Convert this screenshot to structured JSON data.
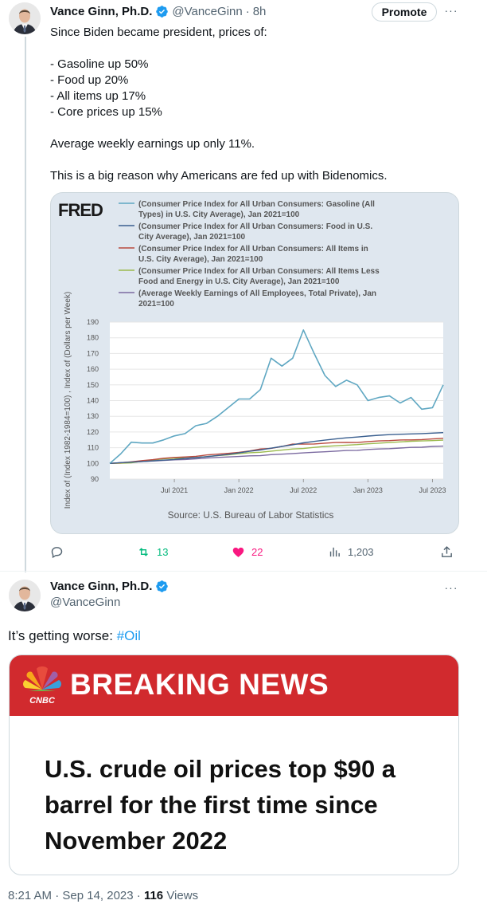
{
  "tweet1": {
    "name": "Vance Ginn, Ph.D.",
    "handle": "@VanceGinn",
    "time": "8h",
    "promote_label": "Promote",
    "more_label": "···",
    "text": "Since Biden became president, prices of:\n\n- Gasoline up 50%\n- Food up 20%\n- All items up 17%\n- Core prices up 15%\n\nAverage weekly earnings up only 11%.\n\nThis is a big reason why Americans are fed up with Bidenomics.",
    "actions": {
      "reply_count": "",
      "retweet_count": "13",
      "like_count": "22",
      "views_count": "1,203"
    },
    "colors": {
      "retweet": "#00ba7c",
      "like": "#f91880",
      "verified": "#1d9bf0"
    }
  },
  "chart": {
    "logo": "FRED",
    "ylabel": "Index of (Index 1982-1984=100) , Index of (Dollars per Week)",
    "source": "Source: U.S. Bureau of Labor Statistics",
    "legend": [
      {
        "lines": [
          "(Consumer Price Index for All Urban Consumers: Gasoline (All",
          "Types) in U.S. City Average), Jan 2021=100"
        ],
        "color": "#5fa7c2"
      },
      {
        "lines": [
          "(Consumer Price Index for All Urban Consumers: Food in U.S.",
          "City Average), Jan 2021=100"
        ],
        "color": "#3a5f8f"
      },
      {
        "lines": [
          "(Consumer Price Index for All Urban Consumers: All Items in",
          "U.S. City Average), Jan 2021=100"
        ],
        "color": "#b94a3f"
      },
      {
        "lines": [
          "(Consumer Price Index for All Urban Consumers: All Items Less",
          "Food and Energy in U.S. City Average), Jan 2021=100"
        ],
        "color": "#9bba4e"
      },
      {
        "lines": [
          "(Average Weekly Earnings of All Employees, Total Private), Jan",
          "2021=100"
        ],
        "color": "#7b6aa0"
      }
    ]
  },
  "chart_data": {
    "type": "line",
    "ylim": [
      90,
      190
    ],
    "yticks": [
      "190",
      "180",
      "170",
      "160",
      "150",
      "140",
      "130",
      "120",
      "110",
      "100",
      "90"
    ],
    "xticks": [
      "Jul 2021",
      "Jan 2022",
      "Jul 2022",
      "Jan 2023",
      "Jul 2023"
    ],
    "x": [
      "Jan 2021",
      "Feb 2021",
      "Mar 2021",
      "Apr 2021",
      "May 2021",
      "Jun 2021",
      "Jul 2021",
      "Aug 2021",
      "Sep 2021",
      "Oct 2021",
      "Nov 2021",
      "Dec 2021",
      "Jan 2022",
      "Feb 2022",
      "Mar 2022",
      "Apr 2022",
      "May 2022",
      "Jun 2022",
      "Jul 2022",
      "Aug 2022",
      "Sep 2022",
      "Oct 2022",
      "Nov 2022",
      "Dec 2022",
      "Jan 2023",
      "Feb 2023",
      "Mar 2023",
      "Apr 2023",
      "May 2023",
      "Jun 2023",
      "Jul 2023",
      "Aug 2023"
    ],
    "series": [
      {
        "values": [
          100,
          106,
          113.5,
          113,
          113,
          115,
          117.5,
          119,
          124,
          125.5,
          130,
          135.5,
          141,
          141,
          147,
          167,
          162,
          167,
          185,
          170,
          156,
          149,
          153,
          150,
          140,
          142,
          143,
          138.5,
          142,
          134.5,
          135.5,
          150
        ]
      },
      {
        "values": [
          100,
          100.5,
          100.8,
          101.2,
          101.6,
          102.1,
          102.5,
          103.2,
          103.7,
          104.3,
          105.0,
          105.8,
          106.7,
          107.7,
          108.6,
          109.7,
          110.8,
          111.9,
          113.1,
          114.0,
          114.8,
          115.6,
          116.3,
          116.8,
          117.4,
          117.9,
          118.3,
          118.6,
          118.8,
          119.0,
          119.3,
          119.6
        ]
      },
      {
        "values": [
          100,
          100.4,
          101.0,
          101.8,
          102.4,
          103.3,
          103.8,
          104.1,
          104.5,
          105.4,
          105.9,
          106.4,
          107.0,
          107.9,
          109.2,
          109.6,
          110.8,
          112.3,
          112.3,
          112.4,
          112.9,
          113.3,
          113.4,
          113.3,
          113.9,
          114.3,
          114.5,
          114.9,
          115.0,
          115.2,
          115.6,
          116.0
        ]
      },
      {
        "values": [
          100,
          100.1,
          100.4,
          101.4,
          102.1,
          103.0,
          103.3,
          103.4,
          103.7,
          104.3,
          104.9,
          105.5,
          106.2,
          106.8,
          107.1,
          107.8,
          108.5,
          109.2,
          109.5,
          110.2,
          110.8,
          111.2,
          111.6,
          112.0,
          112.5,
          112.9,
          113.3,
          113.7,
          114.1,
          114.3,
          114.5,
          114.8
        ]
      },
      {
        "values": [
          100,
          100.3,
          100.6,
          101.2,
          101.5,
          101.9,
          102.3,
          102.5,
          102.9,
          103.4,
          103.8,
          104.1,
          104.4,
          104.8,
          104.9,
          105.6,
          105.9,
          106.3,
          106.7,
          107.1,
          107.4,
          107.8,
          108.2,
          108.3,
          108.9,
          109.2,
          109.4,
          109.8,
          110.2,
          110.3,
          110.8,
          111.0
        ]
      }
    ]
  },
  "tweet2": {
    "name": "Vance Ginn, Ph.D.",
    "handle": "@VanceGinn",
    "more_label": "···",
    "text": "It’s getting worse: ",
    "hashtag": "#Oil",
    "news": {
      "logo_text": "CNBC",
      "banner": "BREAKING NEWS",
      "headline": "U.S. crude oil prices top $90 a barrel for the first time since November 2022",
      "banner_color": "#d12a2e"
    },
    "timestamp": "8:21 AM · Sep 14, 2023 · ",
    "views_count": "116",
    "views_label": " Views"
  }
}
